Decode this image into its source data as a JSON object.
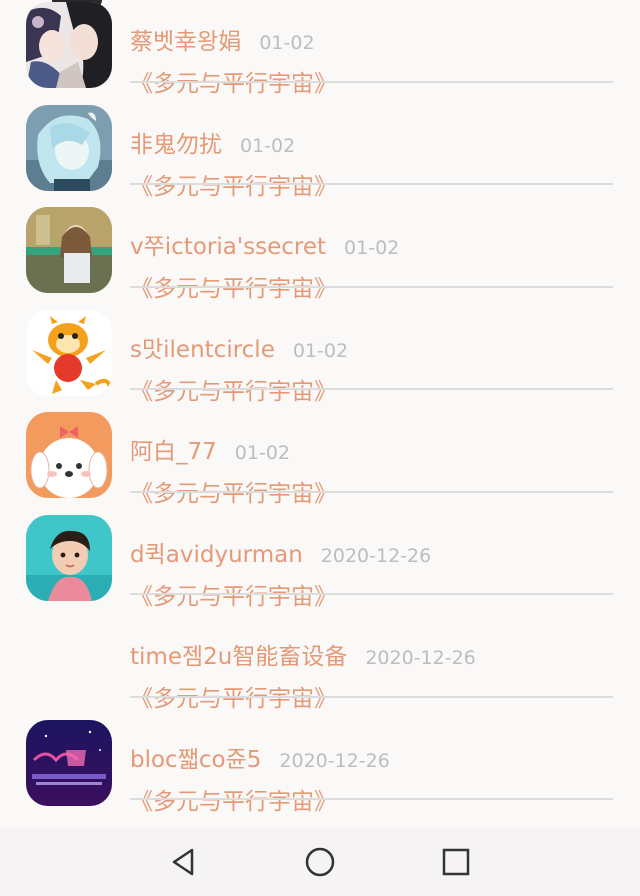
{
  "chat_list": [
    {
      "name": "蔡벳幸왕娟",
      "date": "01-02",
      "message": "《多元与平行宇宙》",
      "avatar": "anime-couple-avatar"
    },
    {
      "name": "非鬼勿扰",
      "date": "01-02",
      "message": "《多元与平行宇宙》",
      "avatar": "blue-hair-girl-avatar"
    },
    {
      "name": "v쭈ictoria'ssecret",
      "date": "01-02",
      "message": "《多元与平行宇宙》",
      "avatar": "photo-girl-avatar"
    },
    {
      "name": "s맛ilentcircle",
      "date": "01-02",
      "message": "《多元与平行宇宙》",
      "avatar": "tiger-cartoon-avatar"
    },
    {
      "name": "阿白_77",
      "date": "01-02",
      "message": "《多元与平行宇宙》",
      "avatar": "puppy-cartoon-avatar"
    },
    {
      "name": "d퀵avidyurman",
      "date": "2020-12-26",
      "message": "《多元与平行宇宙》",
      "avatar": "child-photo-avatar"
    },
    {
      "name": "time젬2u智能畜设备",
      "date": "2020-12-26",
      "message": "《多元与平行宇宙》",
      "avatar": "none"
    },
    {
      "name": "bloc쨃co쥰5",
      "date": "2020-12-26",
      "message": "《多元与平行宇宙》",
      "avatar": "happiness-banner-avatar"
    }
  ],
  "nav": {
    "back": "back-triangle-icon",
    "home": "home-circle-icon",
    "recents": "recents-square-icon"
  },
  "colors": {
    "name": "#e49a76",
    "message": "#e49a76",
    "date": "#bdbdbd",
    "divider": "#dcdcdc",
    "background": "#fbf8f8"
  }
}
